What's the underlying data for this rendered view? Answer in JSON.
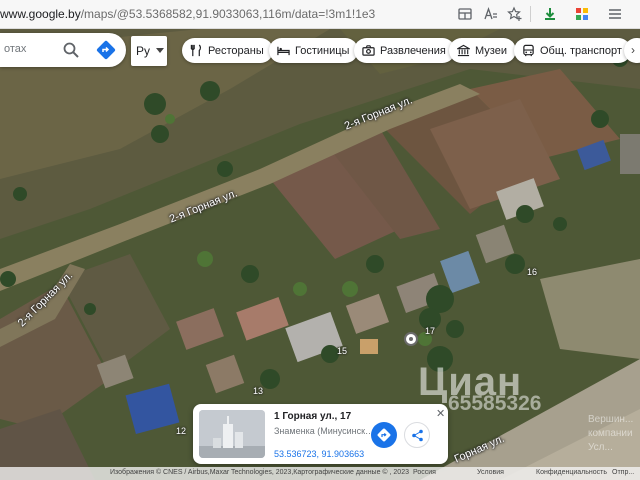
{
  "browser": {
    "url_host": "www.google.by",
    "url_path": "/maps/@53.5368582,91.9033063,116m/data=!3m1!1e3",
    "icons": [
      "tab-grid-icon",
      "reader-mode-icon",
      "favorite-star-icon",
      "download-icon",
      "extensions-icon",
      "menu-icon"
    ]
  },
  "search": {
    "visible_text": "отах",
    "language_label": "Ру"
  },
  "chips": [
    {
      "label": "Рестораны",
      "icon": "fork-knife-icon"
    },
    {
      "label": "Гостиницы",
      "icon": "bed-icon"
    },
    {
      "label": "Развлечения",
      "icon": "camera-icon"
    },
    {
      "label": "Музеи",
      "icon": "museum-icon"
    },
    {
      "label": "Общ. транспорт",
      "icon": "bus-icon"
    }
  ],
  "map": {
    "view": "satellite",
    "street_labels": [
      "2-я Горная ул.",
      "2-я Горная ул.",
      "2-я Горная ул.",
      "Горная ул."
    ],
    "house_numbers": [
      "17",
      "15",
      "13",
      "12",
      "16"
    ]
  },
  "place_card": {
    "title": "1 Горная ул., 17",
    "subtitle": "Знаменка (Минусинск…",
    "coordinates": "53.536723, 91.903663"
  },
  "attribution": {
    "imagery": "Изображения © CNES / Airbus,Maxar Technologies, 2023,Картографические данные © , 2023",
    "country": "Россия",
    "terms": "Условия",
    "privacy": "Конфиденциальность",
    "feedback": "Отпр..."
  },
  "watermark": {
    "brand": "Циан",
    "number": "65585326",
    "side_text_1": "Вершин...",
    "side_text_2": "компании",
    "side_text_3": "Усл..."
  }
}
